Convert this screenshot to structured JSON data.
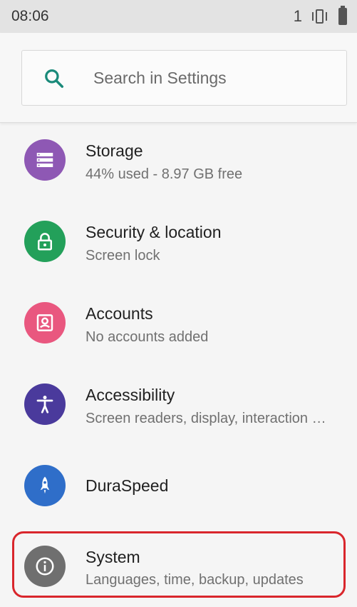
{
  "status_bar": {
    "time": "08:06",
    "notification_count": "1"
  },
  "search": {
    "placeholder": "Search in Settings"
  },
  "items": [
    {
      "title": "Storage",
      "subtitle": "44% used - 8.97 GB free",
      "icon": "storage-icon",
      "color": "#8e58b4"
    },
    {
      "title": "Security & location",
      "subtitle": "Screen lock",
      "icon": "lock-icon",
      "color": "#23a05a"
    },
    {
      "title": "Accounts",
      "subtitle": "No accounts added",
      "icon": "account-icon",
      "color": "#e9577f"
    },
    {
      "title": "Accessibility",
      "subtitle": "Screen readers, display, interaction …",
      "icon": "accessibility-icon",
      "color": "#4a3a9c"
    },
    {
      "title": "DuraSpeed",
      "subtitle": "",
      "icon": "rocket-icon",
      "color": "#2f6ec9"
    },
    {
      "title": "System",
      "subtitle": "Languages, time, backup, updates",
      "icon": "info-icon",
      "color": "#6f6f6f"
    }
  ],
  "colors": {
    "accent": "#1a8a7a",
    "highlight": "#d9262c"
  }
}
